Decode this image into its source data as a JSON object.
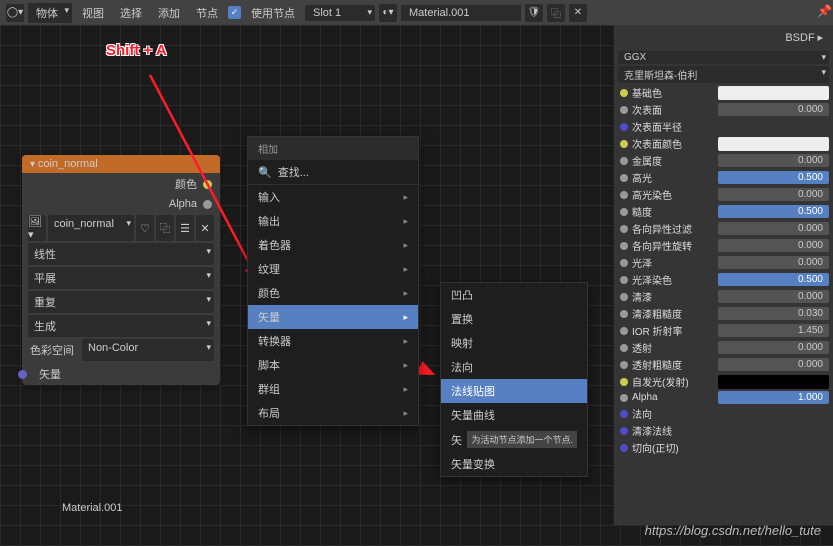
{
  "topbar": {
    "mode": "物体",
    "menus": [
      "视图",
      "选择",
      "添加",
      "节点"
    ],
    "useNodesLabel": "使用节点",
    "slot": "Slot 1",
    "material": "Material.001"
  },
  "annotation": "Shift + A",
  "node": {
    "title": "coin_normal",
    "outputs": [
      "颜色",
      "Alpha"
    ],
    "image": "coin_normal",
    "selects": [
      "线性",
      "平展",
      "重复",
      "生成"
    ],
    "colorspace_label": "色彩空间",
    "colorspace_value": "Non-Color",
    "input": "矢量"
  },
  "menu1": {
    "title": "相加",
    "search": "查找...",
    "items": [
      "输入",
      "输出",
      "着色器",
      "纹理",
      "颜色",
      "矢量",
      "转换器",
      "脚本",
      "群组",
      "布局"
    ],
    "highlighted": "矢量"
  },
  "menu2": {
    "items": [
      "凹凸",
      "置换",
      "映射",
      "法向",
      "法线贴图",
      "矢量曲线",
      "矢",
      "矢量变换"
    ],
    "highlighted": "法线贴图",
    "tooltip": "为活动节点添加一个节点."
  },
  "sidebar": {
    "header": "BSDF",
    "dropdowns": [
      "GGX",
      "克里斯坦森-伯利"
    ],
    "params": [
      {
        "dot": "#cccc4d",
        "label": "基础色",
        "type": "swatch",
        "val": ""
      },
      {
        "dot": "#999",
        "label": "次表面",
        "type": "num",
        "val": "0.000"
      },
      {
        "dot": "#4d4dcc",
        "label": "次表面半径",
        "type": "none",
        "val": ""
      },
      {
        "dot": "#cccc4d",
        "label": "次表面颜色",
        "type": "swatch",
        "val": ""
      },
      {
        "dot": "#999",
        "label": "金属度",
        "type": "num",
        "val": "0.000"
      },
      {
        "dot": "#999",
        "label": "高光",
        "type": "blue",
        "val": "0.500"
      },
      {
        "dot": "#999",
        "label": "高光染色",
        "type": "num",
        "val": "0.000"
      },
      {
        "dot": "#999",
        "label": "糙度",
        "type": "blue",
        "val": "0.500"
      },
      {
        "dot": "#999",
        "label": "各向异性过滤",
        "type": "num",
        "val": "0.000"
      },
      {
        "dot": "#999",
        "label": "各向异性旋转",
        "type": "num",
        "val": "0.000"
      },
      {
        "dot": "#999",
        "label": "光泽",
        "type": "num",
        "val": "0.000"
      },
      {
        "dot": "#999",
        "label": "光泽染色",
        "type": "blue",
        "val": "0.500"
      },
      {
        "dot": "#999",
        "label": "清漆",
        "type": "num",
        "val": "0.000"
      },
      {
        "dot": "#999",
        "label": "清漆粗糙度",
        "type": "num",
        "val": "0.030"
      },
      {
        "dot": "#999",
        "label": "IOR 折射率",
        "type": "num",
        "val": "1.450"
      },
      {
        "dot": "#999",
        "label": "透射",
        "type": "num",
        "val": "0.000"
      },
      {
        "dot": "#999",
        "label": "透射粗糙度",
        "type": "num",
        "val": "0.000"
      },
      {
        "dot": "#cccc4d",
        "label": "自发光(发射)",
        "type": "swatchdark",
        "val": ""
      },
      {
        "dot": "#999",
        "label": "Alpha",
        "type": "blue",
        "val": "1.000"
      },
      {
        "dot": "#4d4dcc",
        "label": "法向",
        "type": "label",
        "val": ""
      },
      {
        "dot": "#4d4dcc",
        "label": "清漆法线",
        "type": "label",
        "val": ""
      },
      {
        "dot": "#4d4dcc",
        "label": "切向(正切)",
        "type": "label",
        "val": ""
      }
    ]
  },
  "bottom_label": "Material.001",
  "watermark": "https://blog.csdn.net/hello_tute"
}
